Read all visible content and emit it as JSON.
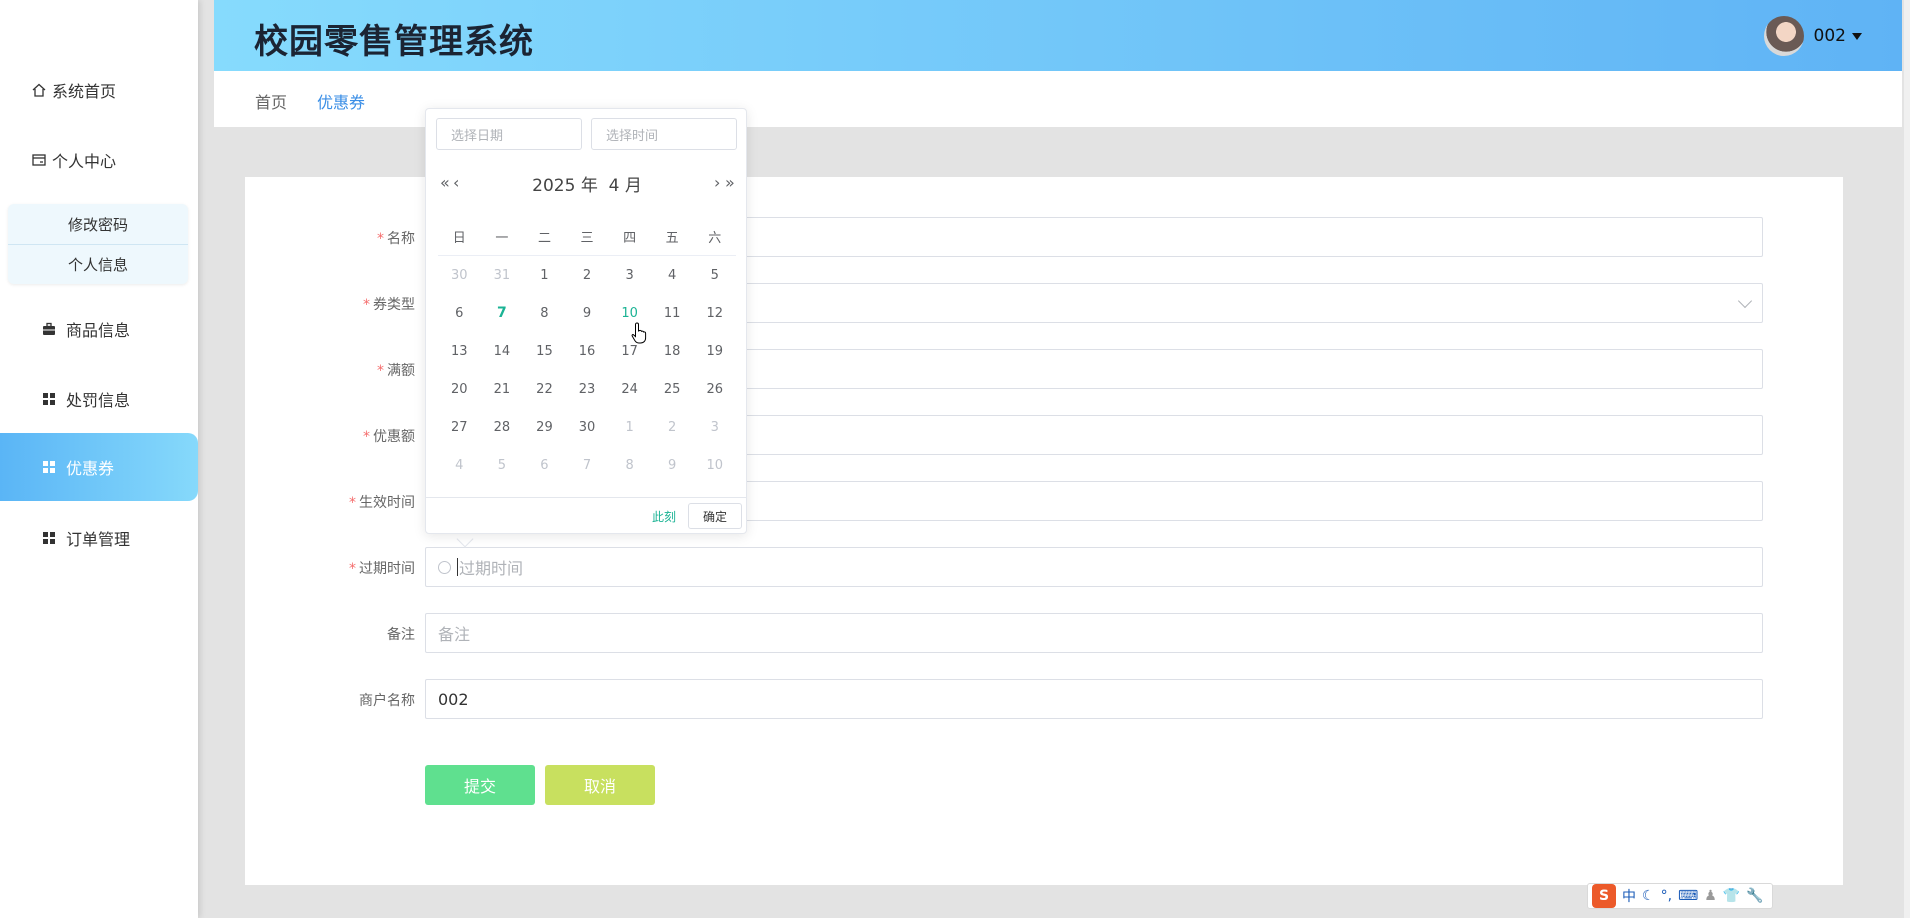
{
  "app": {
    "title": "校园零售管理系统"
  },
  "user": {
    "name": "002"
  },
  "sidebar": {
    "items": [
      {
        "label": "系统首页",
        "icon": "house-icon"
      },
      {
        "label": "个人中心",
        "icon": "card-icon"
      },
      {
        "label": "商品信息",
        "icon": "briefcase-icon"
      },
      {
        "label": "处罚信息",
        "icon": "grid-icon"
      },
      {
        "label": "优惠券",
        "icon": "grid-icon",
        "active": true
      },
      {
        "label": "订单管理",
        "icon": "grid-icon"
      }
    ],
    "subitems": [
      {
        "label": "修改密码"
      },
      {
        "label": "个人信息"
      }
    ]
  },
  "breadcrumb": {
    "home": "首页",
    "current": "优惠券"
  },
  "form": {
    "fields": [
      {
        "label": "名称",
        "required": true,
        "value": ""
      },
      {
        "label": "券类型",
        "required": true,
        "value": ""
      },
      {
        "label": "满额",
        "required": true,
        "value": ""
      },
      {
        "label": "优惠额",
        "required": true,
        "value": ""
      },
      {
        "label": "生效时间",
        "required": true,
        "value": ""
      },
      {
        "label": "过期时间",
        "required": true,
        "placeholder": "过期时间"
      },
      {
        "label": "备注",
        "required": false,
        "placeholder": "备注"
      },
      {
        "label": "商户名称",
        "required": false,
        "value": "002"
      }
    ],
    "submit_label": "提交",
    "cancel_label": "取消"
  },
  "datepicker": {
    "date_placeholder": "选择日期",
    "time_placeholder": "选择时间",
    "year": "2025",
    "year_suffix": "年",
    "month": "4",
    "month_suffix": "月",
    "prev_year": "«",
    "prev_month": "‹",
    "next_month": "›",
    "next_year": "»",
    "weekdays": [
      "日",
      "一",
      "二",
      "三",
      "四",
      "五",
      "六"
    ],
    "weeks": [
      [
        "30",
        "31",
        "1",
        "2",
        "3",
        "4",
        "5"
      ],
      [
        "6",
        "7",
        "8",
        "9",
        "10",
        "11",
        "12"
      ],
      [
        "13",
        "14",
        "15",
        "16",
        "17",
        "18",
        "19"
      ],
      [
        "20",
        "21",
        "22",
        "23",
        "24",
        "25",
        "26"
      ],
      [
        "27",
        "28",
        "29",
        "30",
        "1",
        "2",
        "3"
      ],
      [
        "4",
        "5",
        "6",
        "7",
        "8",
        "9",
        "10"
      ]
    ],
    "today": "7",
    "hover": "10",
    "now_label": "此刻",
    "ok_label": "确定"
  },
  "ime": {
    "logo": "S",
    "mode": "中"
  },
  "colors": {
    "accent": "#1bb394",
    "submit": "#5fe08f",
    "cancel": "#c8e05f",
    "header_start": "#86dbfd",
    "header_end": "#5fb3f5",
    "link": "#3a8ee6"
  }
}
